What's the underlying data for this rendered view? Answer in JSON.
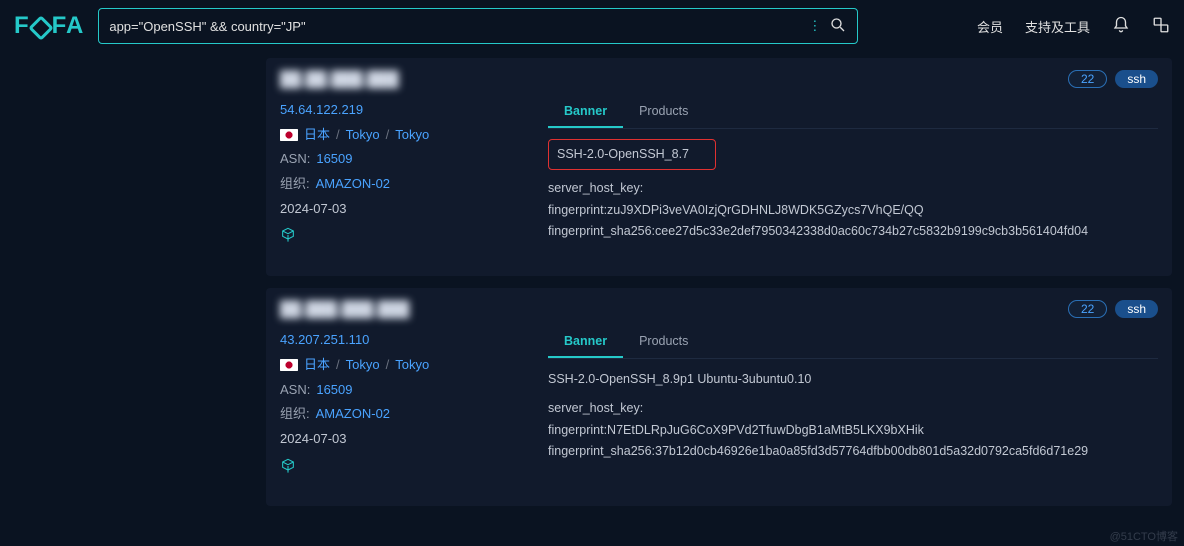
{
  "search": {
    "query": "app=\"OpenSSH\" && country=\"JP\""
  },
  "nav": {
    "member": "会员",
    "tools": "支持及工具"
  },
  "tabs": {
    "banner": "Banner",
    "products": "Products"
  },
  "labels": {
    "asn": "ASN:",
    "org": "组织:"
  },
  "results": [
    {
      "title": "██.██.███.███",
      "port": "22",
      "proto": "ssh",
      "ip": "54.64.122.219",
      "country": "日本",
      "region": "Tokyo",
      "city": "Tokyo",
      "asn": "16509",
      "org": "AMAZON-02",
      "date": "2024-07-03",
      "banner_top": "SSH-2.0-OpenSSH_8.7",
      "highlight": true,
      "banner_lines": [
        "server_host_key:",
        "fingerprint:zuJ9XDPi3veVA0IzjQrGDHNLJ8WDK5GZycs7VhQE/QQ",
        "fingerprint_sha256:cee27d5c33e2def7950342338d0ac60c734b27c5832b9199c9cb3b561404fd04"
      ]
    },
    {
      "title": "██.███.███.███",
      "port": "22",
      "proto": "ssh",
      "ip": "43.207.251.110",
      "country": "日本",
      "region": "Tokyo",
      "city": "Tokyo",
      "asn": "16509",
      "org": "AMAZON-02",
      "date": "2024-07-03",
      "banner_top": "SSH-2.0-OpenSSH_8.9p1 Ubuntu-3ubuntu0.10",
      "highlight": false,
      "banner_lines": [
        "server_host_key:",
        "fingerprint:N7EtDLRpJuG6CoX9PVd2TfuwDbgB1aMtB5LKX9bXHik",
        "fingerprint_sha256:37b12d0cb46926e1ba0a85fd3d57764dfbb00db801d5a32d0792ca5fd6d71e29"
      ]
    }
  ],
  "watermark": "@51CTO博客"
}
